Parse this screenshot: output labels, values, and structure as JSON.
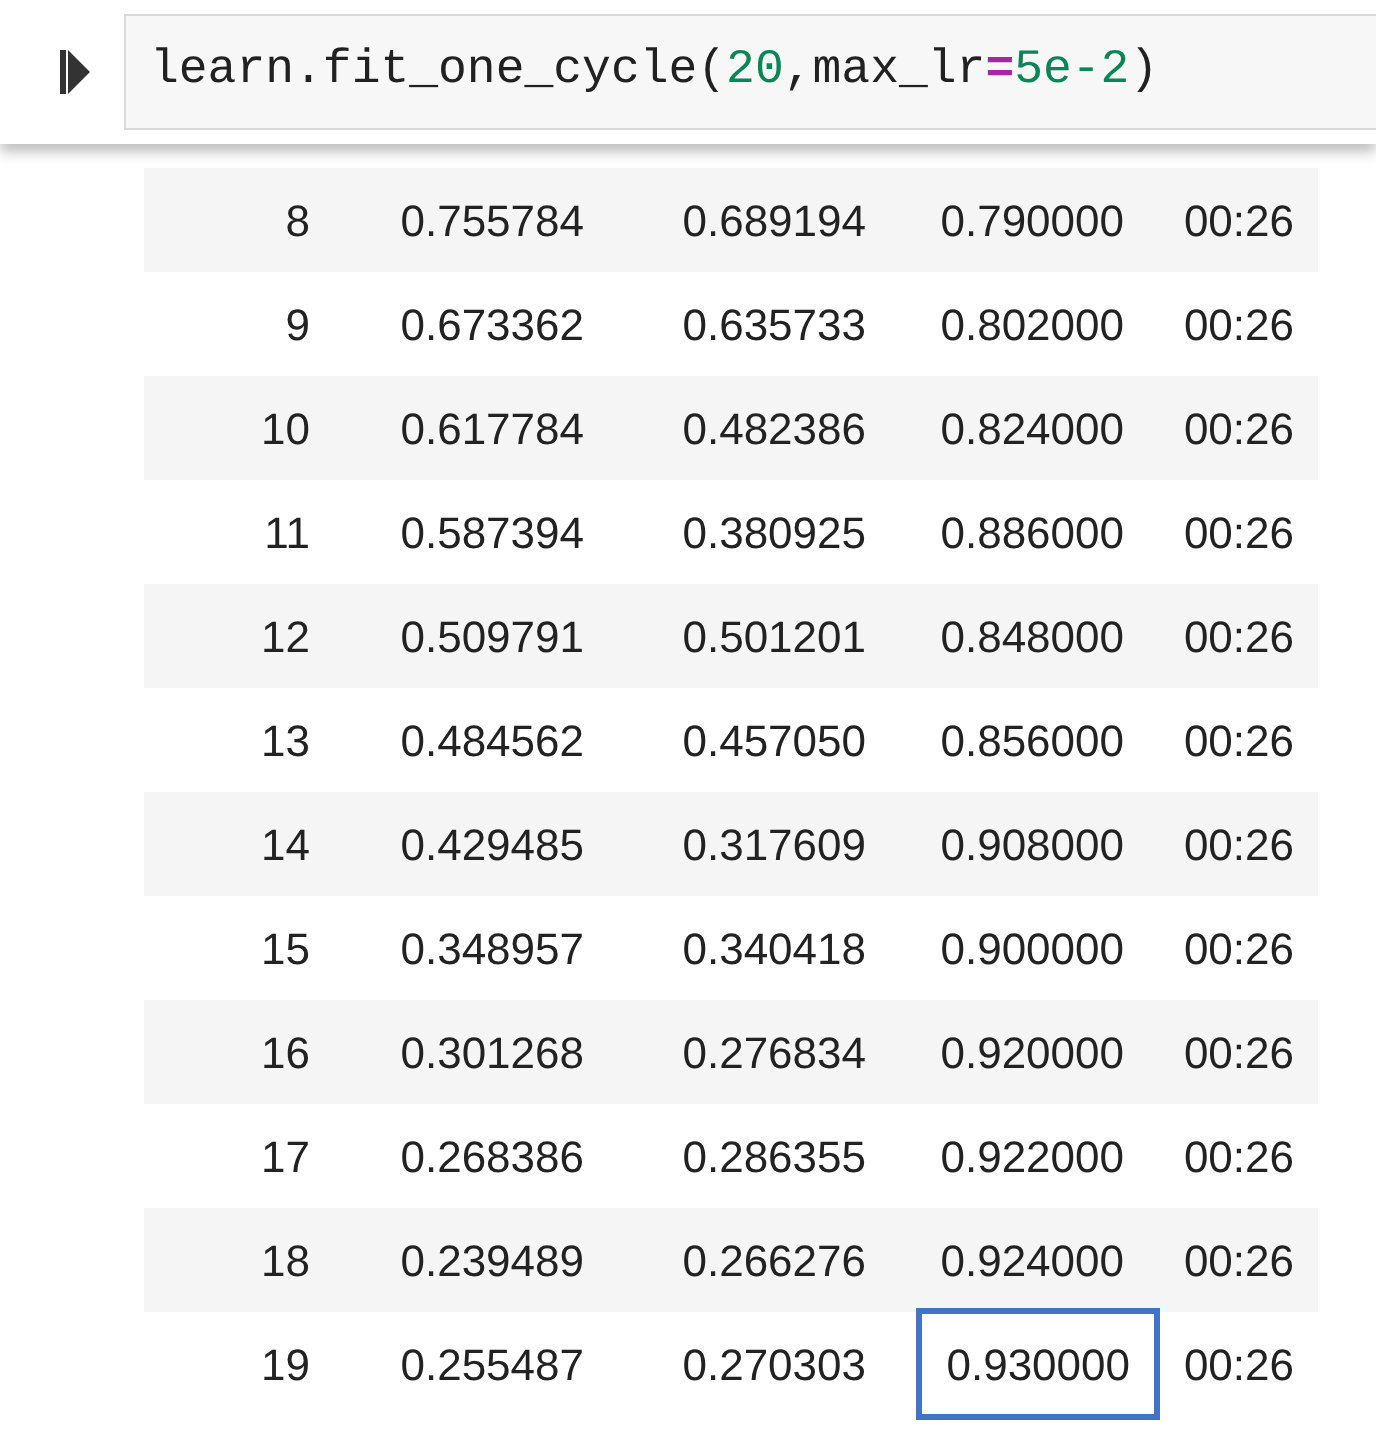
{
  "code_cell": {
    "tokens": [
      {
        "text": "learn.fit_one_cycle(",
        "kind": "plain"
      },
      {
        "text": "20",
        "kind": "number"
      },
      {
        "text": ",max_lr",
        "kind": "plain"
      },
      {
        "text": "=",
        "kind": "operator"
      },
      {
        "text": "5e-2",
        "kind": "number"
      },
      {
        "text": ")",
        "kind": "plain"
      }
    ]
  },
  "table": {
    "rows": [
      {
        "cells": [
          {
            "text": "8",
            "highlighted": false
          },
          {
            "text": "0.755784",
            "highlighted": false
          },
          {
            "text": "0.689194",
            "highlighted": false
          },
          {
            "text": "0.790000",
            "highlighted": false
          },
          {
            "text": "00:26",
            "highlighted": false
          }
        ]
      },
      {
        "cells": [
          {
            "text": "9",
            "highlighted": false
          },
          {
            "text": "0.673362",
            "highlighted": false
          },
          {
            "text": "0.635733",
            "highlighted": false
          },
          {
            "text": "0.802000",
            "highlighted": false
          },
          {
            "text": "00:26",
            "highlighted": false
          }
        ]
      },
      {
        "cells": [
          {
            "text": "10",
            "highlighted": false
          },
          {
            "text": "0.617784",
            "highlighted": false
          },
          {
            "text": "0.482386",
            "highlighted": false
          },
          {
            "text": "0.824000",
            "highlighted": false
          },
          {
            "text": "00:26",
            "highlighted": false
          }
        ]
      },
      {
        "cells": [
          {
            "text": "11",
            "highlighted": false
          },
          {
            "text": "0.587394",
            "highlighted": false
          },
          {
            "text": "0.380925",
            "highlighted": false
          },
          {
            "text": "0.886000",
            "highlighted": false
          },
          {
            "text": "00:26",
            "highlighted": false
          }
        ]
      },
      {
        "cells": [
          {
            "text": "12",
            "highlighted": false
          },
          {
            "text": "0.509791",
            "highlighted": false
          },
          {
            "text": "0.501201",
            "highlighted": false
          },
          {
            "text": "0.848000",
            "highlighted": false
          },
          {
            "text": "00:26",
            "highlighted": false
          }
        ]
      },
      {
        "cells": [
          {
            "text": "13",
            "highlighted": false
          },
          {
            "text": "0.484562",
            "highlighted": false
          },
          {
            "text": "0.457050",
            "highlighted": false
          },
          {
            "text": "0.856000",
            "highlighted": false
          },
          {
            "text": "00:26",
            "highlighted": false
          }
        ]
      },
      {
        "cells": [
          {
            "text": "14",
            "highlighted": false
          },
          {
            "text": "0.429485",
            "highlighted": false
          },
          {
            "text": "0.317609",
            "highlighted": false
          },
          {
            "text": "0.908000",
            "highlighted": false
          },
          {
            "text": "00:26",
            "highlighted": false
          }
        ]
      },
      {
        "cells": [
          {
            "text": "15",
            "highlighted": false
          },
          {
            "text": "0.348957",
            "highlighted": false
          },
          {
            "text": "0.340418",
            "highlighted": false
          },
          {
            "text": "0.900000",
            "highlighted": false
          },
          {
            "text": "00:26",
            "highlighted": false
          }
        ]
      },
      {
        "cells": [
          {
            "text": "16",
            "highlighted": false
          },
          {
            "text": "0.301268",
            "highlighted": false
          },
          {
            "text": "0.276834",
            "highlighted": false
          },
          {
            "text": "0.920000",
            "highlighted": false
          },
          {
            "text": "00:26",
            "highlighted": false
          }
        ]
      },
      {
        "cells": [
          {
            "text": "17",
            "highlighted": false
          },
          {
            "text": "0.268386",
            "highlighted": false
          },
          {
            "text": "0.286355",
            "highlighted": false
          },
          {
            "text": "0.922000",
            "highlighted": false
          },
          {
            "text": "00:26",
            "highlighted": false
          }
        ]
      },
      {
        "cells": [
          {
            "text": "18",
            "highlighted": false
          },
          {
            "text": "0.239489",
            "highlighted": false
          },
          {
            "text": "0.266276",
            "highlighted": false
          },
          {
            "text": "0.924000",
            "highlighted": false
          },
          {
            "text": "00:26",
            "highlighted": false
          }
        ]
      },
      {
        "cells": [
          {
            "text": "19",
            "highlighted": false
          },
          {
            "text": "0.255487",
            "highlighted": false
          },
          {
            "text": "0.270303",
            "highlighted": false
          },
          {
            "text": "0.930000",
            "highlighted": true
          },
          {
            "text": "00:26",
            "highlighted": false
          }
        ]
      }
    ]
  }
}
